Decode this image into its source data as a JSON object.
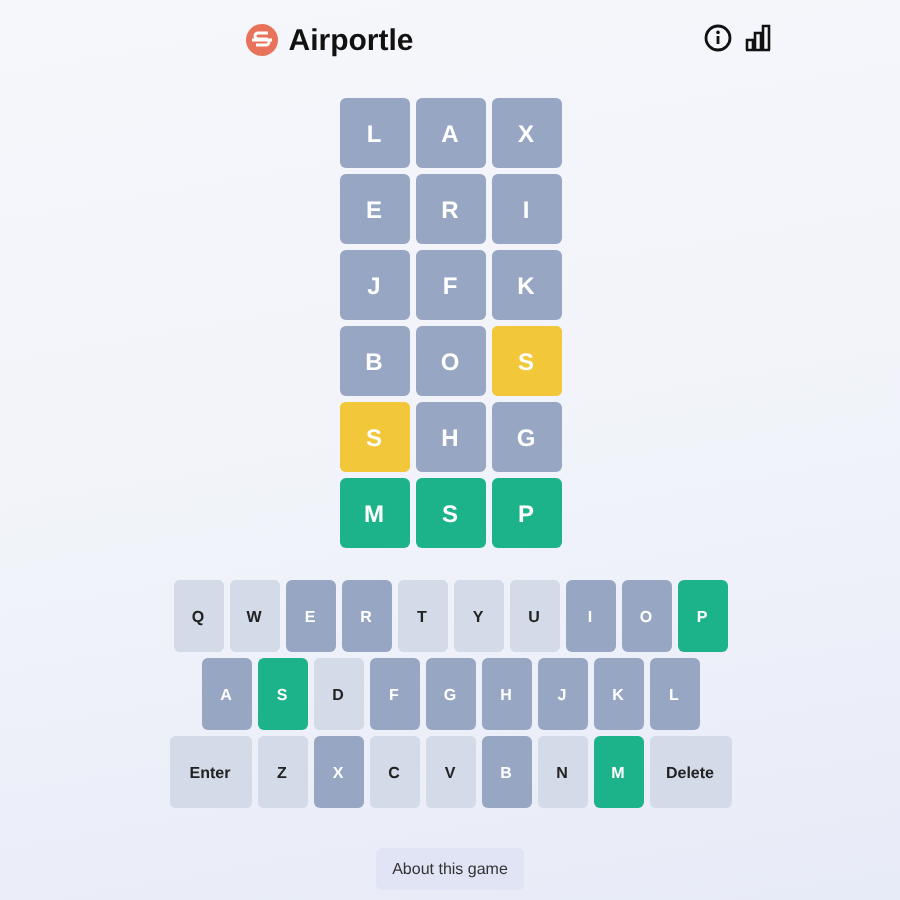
{
  "header": {
    "title": "Airportle"
  },
  "board": [
    [
      {
        "letter": "L",
        "correct": false,
        "present": false
      },
      {
        "letter": "A",
        "correct": false,
        "present": false
      },
      {
        "letter": "X",
        "correct": false,
        "present": false
      }
    ],
    [
      {
        "letter": "E",
        "correct": false,
        "present": false
      },
      {
        "letter": "R",
        "correct": false,
        "present": false
      },
      {
        "letter": "I",
        "correct": false,
        "present": false
      }
    ],
    [
      {
        "letter": "J",
        "correct": false,
        "present": false
      },
      {
        "letter": "F",
        "correct": false,
        "present": false
      },
      {
        "letter": "K",
        "correct": false,
        "present": false
      }
    ],
    [
      {
        "letter": "B",
        "correct": false,
        "present": false
      },
      {
        "letter": "O",
        "correct": false,
        "present": false
      },
      {
        "letter": "S",
        "correct": false,
        "present": true
      }
    ],
    [
      {
        "letter": "S",
        "correct": false,
        "present": true
      },
      {
        "letter": "H",
        "correct": false,
        "present": false
      },
      {
        "letter": "G",
        "correct": false,
        "present": false
      }
    ],
    [
      {
        "letter": "M",
        "correct": true,
        "present": false
      },
      {
        "letter": "S",
        "correct": true,
        "present": false
      },
      {
        "letter": "P",
        "correct": true,
        "present": false
      }
    ]
  ],
  "keyboard": [
    [
      {
        "label": "Q",
        "used": false,
        "correct": false
      },
      {
        "label": "W",
        "used": false,
        "correct": false
      },
      {
        "label": "E",
        "used": true,
        "correct": false
      },
      {
        "label": "R",
        "used": true,
        "correct": false
      },
      {
        "label": "T",
        "used": false,
        "correct": false
      },
      {
        "label": "Y",
        "used": false,
        "correct": false
      },
      {
        "label": "U",
        "used": false,
        "correct": false
      },
      {
        "label": "I",
        "used": true,
        "correct": false
      },
      {
        "label": "O",
        "used": true,
        "correct": false
      },
      {
        "label": "P",
        "used": true,
        "correct": true
      }
    ],
    [
      {
        "label": "A",
        "used": true,
        "correct": false
      },
      {
        "label": "S",
        "used": true,
        "correct": true
      },
      {
        "label": "D",
        "used": false,
        "correct": false
      },
      {
        "label": "F",
        "used": true,
        "correct": false
      },
      {
        "label": "G",
        "used": true,
        "correct": false
      },
      {
        "label": "H",
        "used": true,
        "correct": false
      },
      {
        "label": "J",
        "used": true,
        "correct": false
      },
      {
        "label": "K",
        "used": true,
        "correct": false
      },
      {
        "label": "L",
        "used": true,
        "correct": false
      }
    ],
    [
      {
        "label": "Enter",
        "kind": "wide",
        "used": false,
        "correct": false
      },
      {
        "label": "Z",
        "kind": "letter",
        "used": false,
        "correct": false
      },
      {
        "label": "X",
        "kind": "letter",
        "used": true,
        "correct": false
      },
      {
        "label": "C",
        "kind": "letter",
        "used": false,
        "correct": false
      },
      {
        "label": "V",
        "kind": "letter",
        "used": false,
        "correct": false
      },
      {
        "label": "B",
        "kind": "letter",
        "used": true,
        "correct": false
      },
      {
        "label": "N",
        "kind": "letter",
        "used": false,
        "correct": false
      },
      {
        "label": "M",
        "kind": "letter",
        "used": true,
        "correct": true
      },
      {
        "label": "Delete",
        "kind": "wide",
        "used": false,
        "correct": false
      }
    ]
  ],
  "about_button": "About this game"
}
